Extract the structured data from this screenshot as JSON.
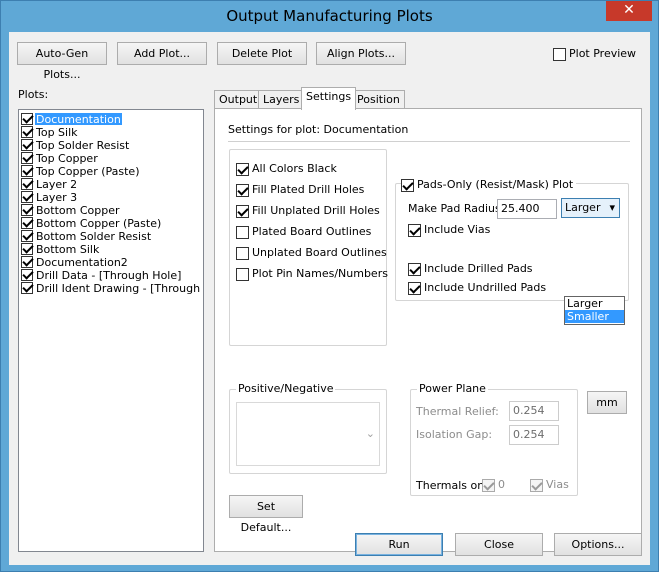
{
  "window": {
    "title": "Output Manufacturing Plots",
    "close_glyph": "✕"
  },
  "toolbar": {
    "auto_gen_label": "Auto-Gen Plots...",
    "add_plot_label": "Add Plot...",
    "delete_plot_label": "Delete Plot",
    "align_plots_label": "Align Plots...",
    "plot_preview_label": "Plot Preview",
    "plot_preview_checked": false
  },
  "plots": {
    "label": "Plots:",
    "items": [
      {
        "label": "Documentation",
        "checked": true,
        "selected": true
      },
      {
        "label": "Top Silk",
        "checked": true
      },
      {
        "label": "Top Solder Resist",
        "checked": true
      },
      {
        "label": "Top Copper",
        "checked": true
      },
      {
        "label": "Top Copper (Paste)",
        "checked": true
      },
      {
        "label": "Layer 2",
        "checked": true
      },
      {
        "label": "Layer 3",
        "checked": true
      },
      {
        "label": "Bottom Copper",
        "checked": true
      },
      {
        "label": "Bottom Copper (Paste)",
        "checked": true
      },
      {
        "label": "Bottom Solder Resist",
        "checked": true
      },
      {
        "label": "Bottom Silk",
        "checked": true
      },
      {
        "label": "Documentation2",
        "checked": true
      },
      {
        "label": "Drill Data - [Through Hole]",
        "checked": true
      },
      {
        "label": "Drill Ident Drawing - [Through Hole]",
        "checked": true
      }
    ]
  },
  "tabs": [
    {
      "label": "Output"
    },
    {
      "label": "Layers"
    },
    {
      "label": "Settings",
      "active": true
    },
    {
      "label": "Position"
    }
  ],
  "settings": {
    "header": "Settings for plot: Documentation",
    "options": [
      {
        "label": "All Colors Black",
        "checked": true
      },
      {
        "label": "Fill Plated Drill Holes",
        "checked": true
      },
      {
        "label": "Fill Unplated Drill Holes",
        "checked": true
      },
      {
        "label": "Plated Board Outlines",
        "checked": false
      },
      {
        "label": "Unplated Board Outlines",
        "checked": false
      },
      {
        "label": "Plot Pin Names/Numbers",
        "checked": false
      }
    ],
    "pads_only": {
      "label": "Pads-Only (Resist/Mask) Plot",
      "checked": true,
      "radius_label": "Make Pad Radius:",
      "radius_value": "25.400",
      "size_selected": "Larger",
      "size_options": [
        "Larger",
        "Smaller"
      ],
      "size_highlighted": "Smaller",
      "include_vias_label": "Include Vias",
      "include_vias_checked": true,
      "include_drilled_label": "Include Drilled Pads",
      "include_drilled_checked": true,
      "include_undrilled_label": "Include Undrilled Pads",
      "include_undrilled_checked": true
    },
    "positive_negative": {
      "label": "Positive/Negative"
    },
    "power_plane": {
      "label": "Power Plane",
      "thermal_relief_label": "Thermal Relief:",
      "thermal_relief_value": "0.254",
      "isolation_gap_label": "Isolation Gap:",
      "isolation_gap_value": "0.254",
      "thermals_on_label": "Thermals on:",
      "thermals_zero_label": "0",
      "thermals_zero_checked": true,
      "thermals_vias_label": "Vias",
      "thermals_vias_checked": true
    },
    "units_label": "mm",
    "set_default_label": "Set Default..."
  },
  "footer": {
    "run_label": "Run",
    "close_label": "Close",
    "options_label": "Options..."
  },
  "colors": {
    "selection": "#3399ff",
    "title_bar": "#5fa8d6",
    "close_button": "#c7392a"
  }
}
